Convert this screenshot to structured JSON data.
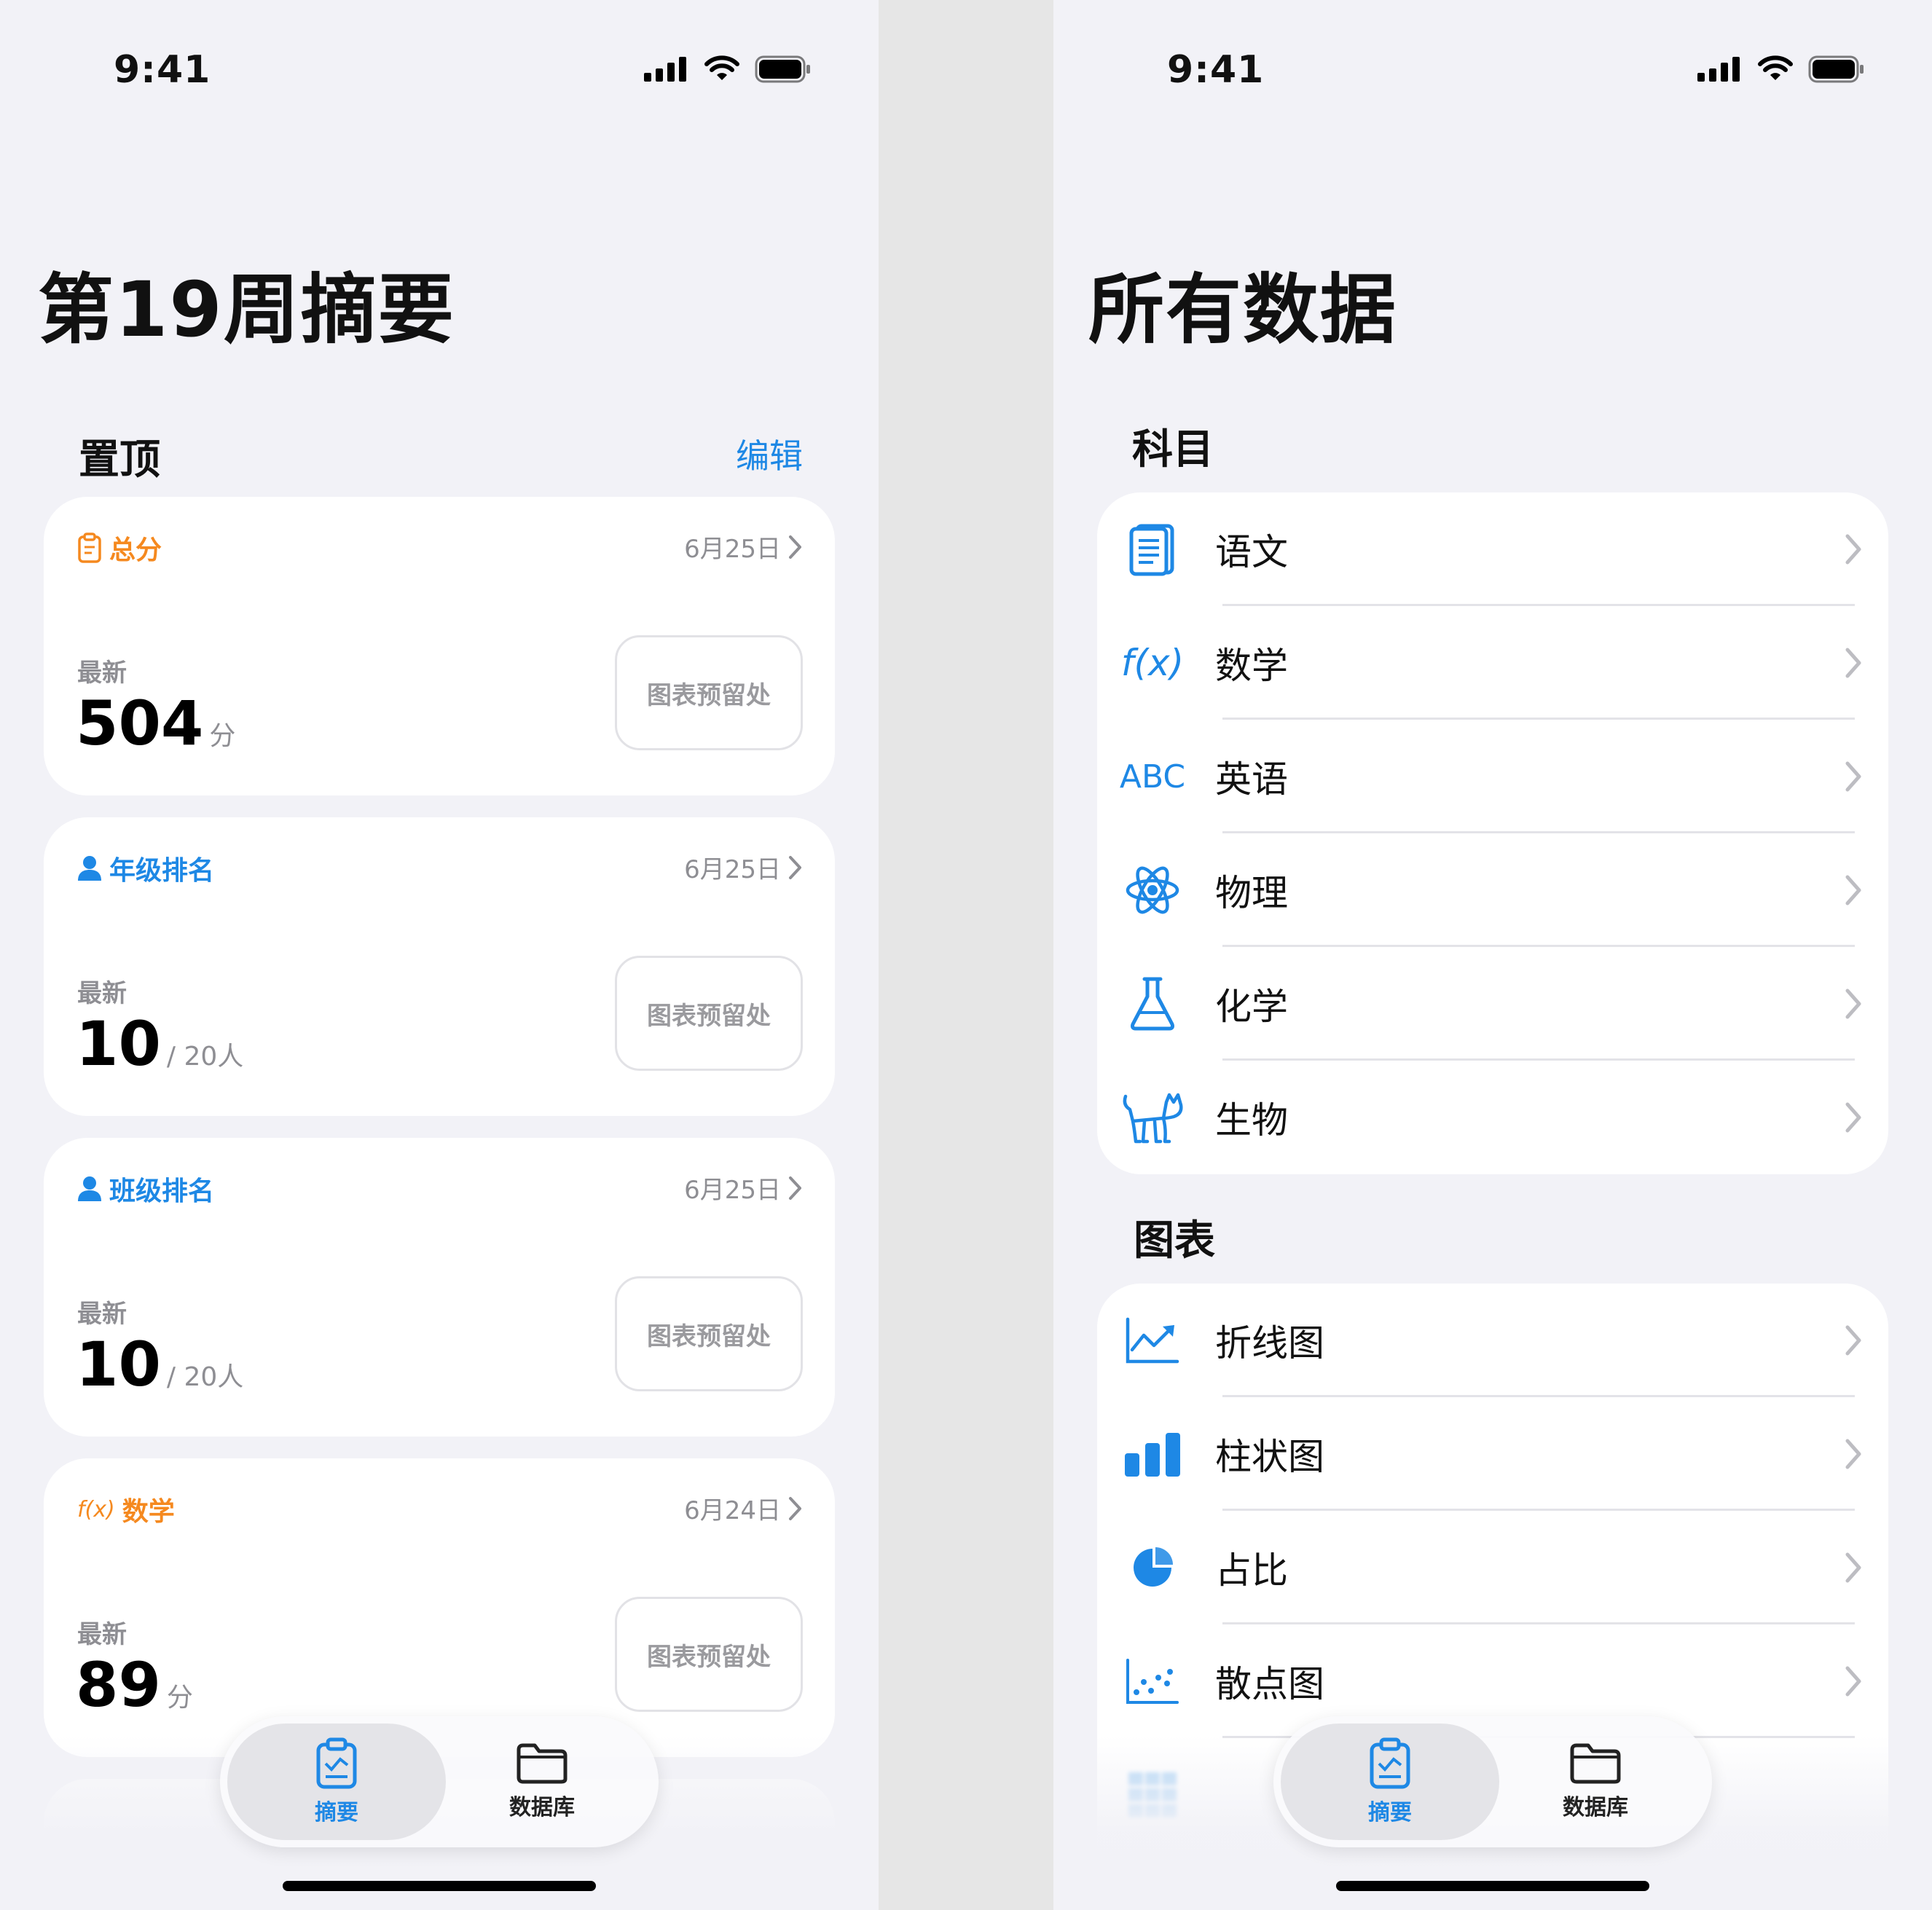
{
  "status": {
    "time": "9:41"
  },
  "left": {
    "title": "第19周摘要",
    "section_title": "置顶",
    "edit_label": "编辑",
    "cards": [
      {
        "icon": "clipboard-icon",
        "name": "总分",
        "color": "#F5891F",
        "date": "6月25日",
        "latest_label": "最新",
        "value": "504",
        "unit": "分",
        "placeholder": "图表预留处"
      },
      {
        "icon": "person-icon",
        "name": "年级排名",
        "color": "#1E88E5",
        "date": "6月25日",
        "latest_label": "最新",
        "value": "10",
        "unit": "/ 20人",
        "placeholder": "图表预留处"
      },
      {
        "icon": "person-icon",
        "name": "班级排名",
        "color": "#1E88E5",
        "date": "6月25日",
        "latest_label": "最新",
        "value": "10",
        "unit": "/ 20人",
        "placeholder": "图表预留处"
      },
      {
        "icon": "function-icon",
        "name": "数学",
        "color": "#F5891F",
        "date": "6月24日",
        "latest_label": "最新",
        "value": "89",
        "unit": "分",
        "placeholder": "图表预留处"
      }
    ]
  },
  "right": {
    "title": "所有数据",
    "subjects_title": "科目",
    "subjects": [
      {
        "label": "语文",
        "icon": "document-icon"
      },
      {
        "label": "数学",
        "icon": "function-icon"
      },
      {
        "label": "英语",
        "icon": "abc-icon"
      },
      {
        "label": "物理",
        "icon": "atom-icon"
      },
      {
        "label": "化学",
        "icon": "flask-icon"
      },
      {
        "label": "生物",
        "icon": "cat-icon"
      }
    ],
    "charts_title": "图表",
    "charts": [
      {
        "label": "折线图",
        "icon": "line-chart-icon"
      },
      {
        "label": "柱状图",
        "icon": "bar-chart-icon"
      },
      {
        "label": "占比",
        "icon": "pie-chart-icon"
      },
      {
        "label": "散点图",
        "icon": "scatter-chart-icon"
      }
    ],
    "abc_text": "ABC",
    "fx_text": "f(x)"
  },
  "tabbar": {
    "summary_label": "摘要",
    "database_label": "数据库"
  },
  "colors": {
    "accent": "#1E88E5",
    "orange": "#F5891F",
    "background": "#F2F2F7",
    "card": "#FFFFFF"
  }
}
